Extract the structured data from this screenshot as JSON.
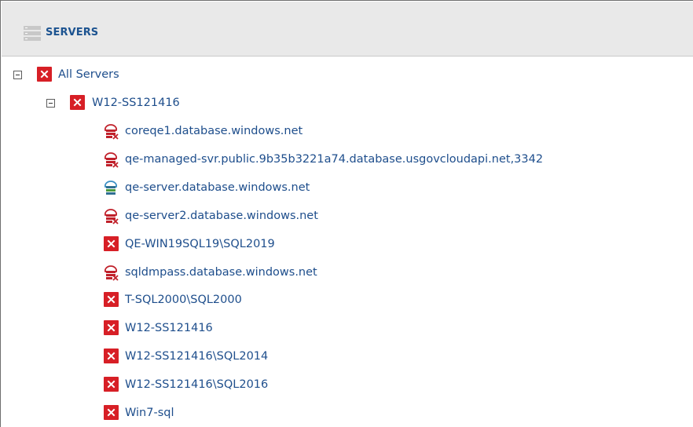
{
  "header": {
    "title": "SERVERS",
    "icon": "servers-icon"
  },
  "tree": {
    "root": {
      "label": "All Servers",
      "status": "error",
      "expanded": true
    },
    "group": {
      "label": "W12-SS121416",
      "status": "error",
      "expanded": true
    },
    "items": [
      {
        "label": "coreqe1.database.windows.net",
        "status": "cloud-error"
      },
      {
        "label": "qe-managed-svr.public.9b35b3221a74.database.usgovcloudapi.net,3342",
        "status": "cloud-error"
      },
      {
        "label": "qe-server.database.windows.net",
        "status": "cloud-ok"
      },
      {
        "label": "qe-server2.database.windows.net",
        "status": "cloud-error"
      },
      {
        "label": "QE-WIN19SQL19\\SQL2019",
        "status": "error"
      },
      {
        "label": "sqldmpass.database.windows.net",
        "status": "cloud-error"
      },
      {
        "label": "T-SQL2000\\SQL2000",
        "status": "error"
      },
      {
        "label": "W12-SS121416",
        "status": "error"
      },
      {
        "label": "W12-SS121416\\SQL2014",
        "status": "error"
      },
      {
        "label": "W12-SS121416\\SQL2016",
        "status": "error"
      },
      {
        "label": "Win7-sql",
        "status": "error"
      }
    ]
  },
  "colors": {
    "link": "#1e4e8c",
    "header_title": "#1c5390",
    "error": "#d71f26",
    "header_bg": "#e9e9e9"
  }
}
